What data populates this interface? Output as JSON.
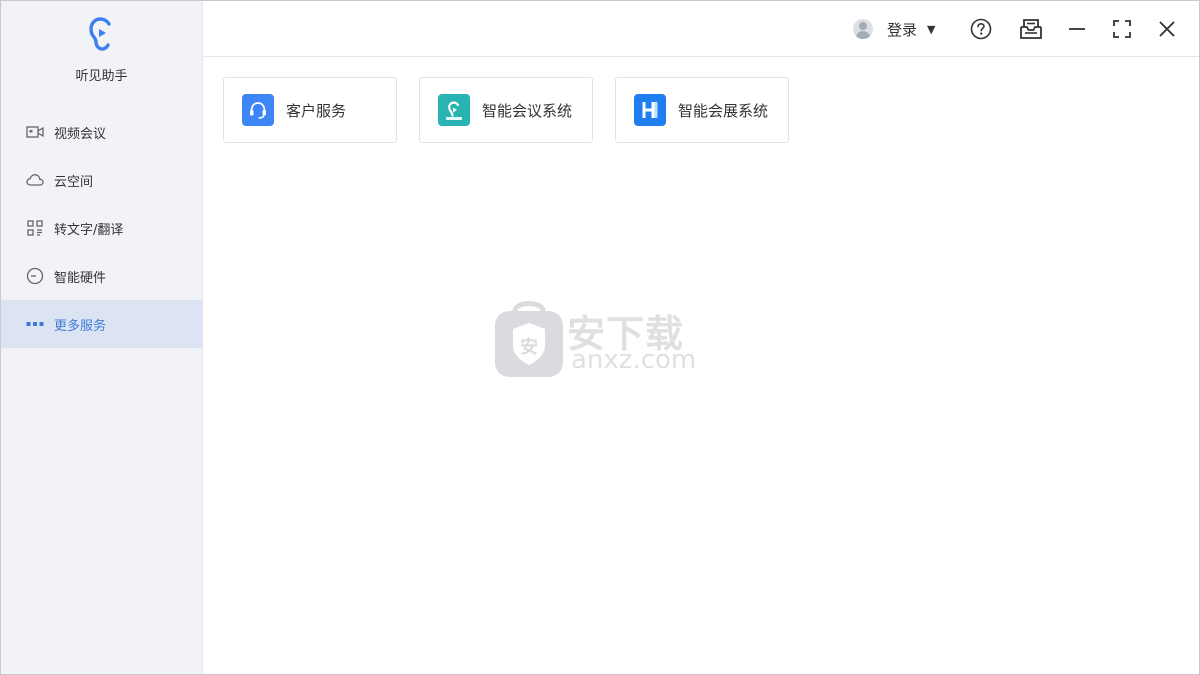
{
  "app": {
    "name": "听见助手"
  },
  "sidebar": {
    "items": [
      {
        "label": "视频会议",
        "icon": "video-camera-icon",
        "active": false
      },
      {
        "label": "云空间",
        "icon": "cloud-icon",
        "active": false
      },
      {
        "label": "转文字/翻译",
        "icon": "scan-text-icon",
        "active": false
      },
      {
        "label": "智能硬件",
        "icon": "hardware-icon",
        "active": false
      },
      {
        "label": "更多服务",
        "icon": "more-dots-icon",
        "active": true
      }
    ]
  },
  "topbar": {
    "login_label": "登录",
    "dropdown_arrow": "▼",
    "icons": [
      "user-avatar-icon",
      "help-icon",
      "inbox-icon",
      "minimize-icon",
      "maximize-icon",
      "close-icon"
    ]
  },
  "services": [
    {
      "label": "客户服务",
      "icon": "customer-service-icon",
      "color": "#3d86f5"
    },
    {
      "label": "智能会议系统",
      "icon": "meeting-system-icon",
      "color": "#28b4b2"
    },
    {
      "label": "智能会展系统",
      "icon": "exhibition-system-icon",
      "color": "#1f7ff0"
    }
  ],
  "watermark": {
    "title": "安下载",
    "domain": "anxz.com",
    "badge": "安"
  },
  "colors": {
    "accent": "#3f7ad8",
    "sidebar_bg": "#f2f3f7",
    "active_bg": "#dce4f3"
  }
}
